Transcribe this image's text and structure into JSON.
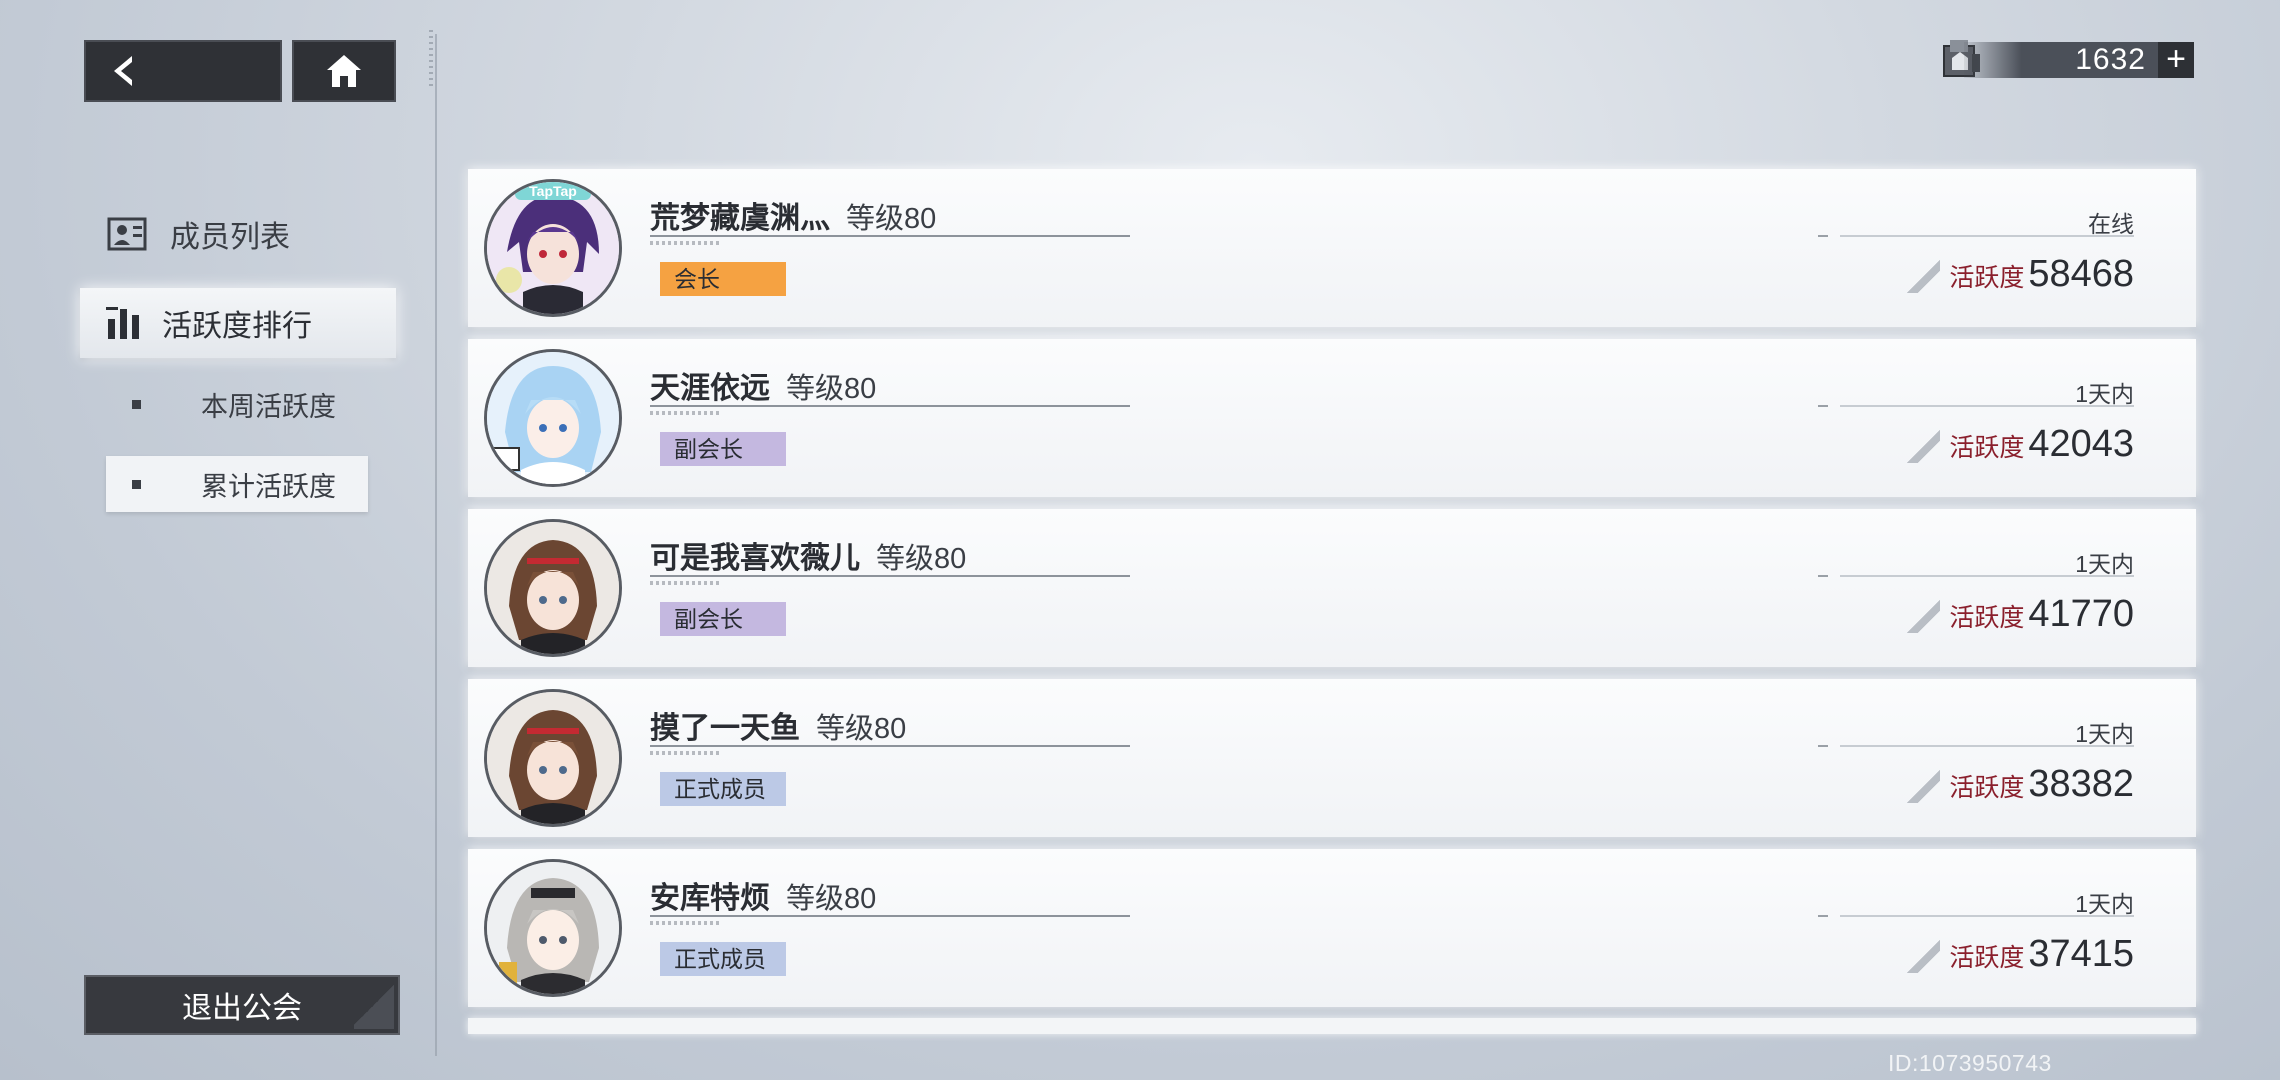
{
  "currency": {
    "amount": "1632",
    "add_symbol": "+"
  },
  "sidebar": {
    "title": "成员列表",
    "active_tab": "活跃度排行",
    "sub_items": [
      {
        "label": "本周活跃度"
      },
      {
        "label": "累计活跃度"
      }
    ],
    "quit_label": "退出公会"
  },
  "members": [
    {
      "name": "荒梦藏虞渊灬",
      "level": "等级80",
      "role": "会长",
      "status": "在线",
      "activity_label": "活跃度",
      "activity": "58468"
    },
    {
      "name": "天涯依远",
      "level": "等级80",
      "role": "副会长",
      "status": "1天内",
      "activity_label": "活跃度",
      "activity": "42043"
    },
    {
      "name": "可是我喜欢薇儿",
      "level": "等级80",
      "role": "副会长",
      "status": "1天内",
      "activity_label": "活跃度",
      "activity": "41770"
    },
    {
      "name": "摸了一天鱼",
      "level": "等级80",
      "role": "正式成员",
      "status": "1天内",
      "activity_label": "活跃度",
      "activity": "38382"
    },
    {
      "name": "安库特烦",
      "level": "等级80",
      "role": "正式成员",
      "status": "1天内",
      "activity_label": "活跃度",
      "activity": "37415"
    }
  ],
  "avatar_badge": "TapTap",
  "footer": {
    "player_id": "ID:1073950743"
  },
  "colors": {
    "leader_tag": "#f5a242",
    "vice_tag": "#c4b8e0",
    "member_tag": "#bcc9e6",
    "activity_label": "#8a1f2c"
  }
}
